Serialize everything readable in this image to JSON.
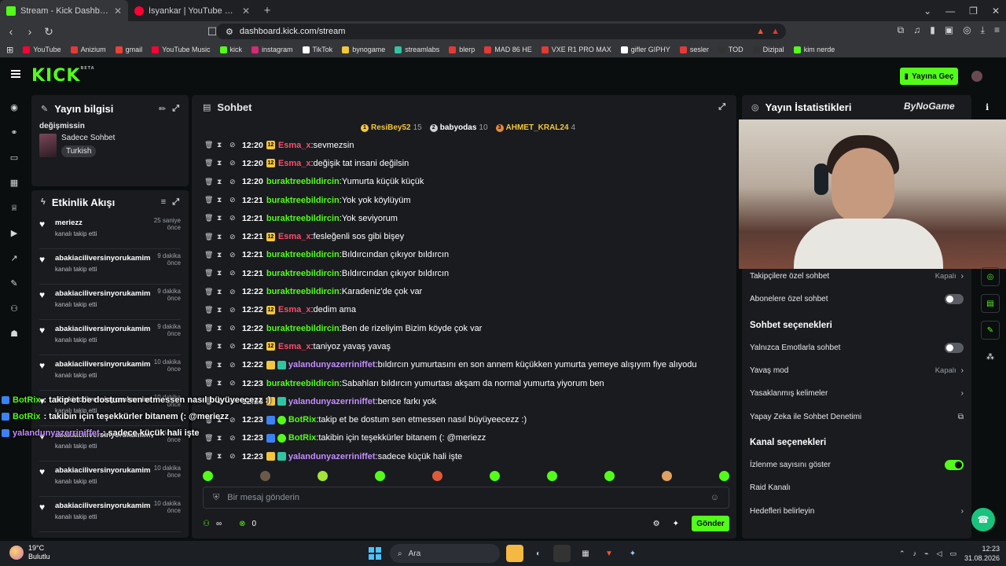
{
  "browser": {
    "tabs": [
      {
        "title": "Stream - Kick Dashboard",
        "color": "#53fc18",
        "active": true
      },
      {
        "title": "İsyankar | YouTube Music",
        "color": "#ff0033",
        "active": false
      }
    ],
    "url": "dashboard.kick.com/stream",
    "bookmarks": [
      {
        "label": "YouTube",
        "color": "#ff0033"
      },
      {
        "label": "Anizium",
        "color": "#e53935"
      },
      {
        "label": "gmail",
        "color": "#ea4335"
      },
      {
        "label": "YouTube Music",
        "color": "#ff0033"
      },
      {
        "label": "kick",
        "color": "#53fc18"
      },
      {
        "label": "instagram",
        "color": "#d62976"
      },
      {
        "label": "TikTok",
        "color": "#ffffff"
      },
      {
        "label": "bynogame",
        "color": "#f4c63b"
      },
      {
        "label": "streamlabs",
        "color": "#31c3a2"
      },
      {
        "label": "blerp",
        "color": "#e53935"
      },
      {
        "label": "MAD 86 HE",
        "color": "#e53935"
      },
      {
        "label": "VXE R1 PRO MAX",
        "color": "#e53935"
      },
      {
        "label": "gifler GIPHY",
        "color": "#ffffff"
      },
      {
        "label": "sesler",
        "color": "#e53935"
      },
      {
        "label": "TOD",
        "color": "#333333"
      },
      {
        "label": "Dizipal",
        "color": "#333333"
      },
      {
        "label": "kim nerde",
        "color": "#53fc18"
      }
    ]
  },
  "header": {
    "logo": "KICK",
    "logo_beta": "BETA",
    "go_live": "Yayına Geç"
  },
  "stream_info": {
    "heading": "Yayın bilgisi",
    "title": "değişmissin",
    "category": "Sadece Sohbet",
    "tag": "Turkish"
  },
  "activity": {
    "heading": "Etkinlik Akışı",
    "items": [
      {
        "user": "meriezz",
        "action": "kanalı takip etti",
        "time": "25 saniye önce"
      },
      {
        "user": "abakiaciliversinyorukamim",
        "action": "kanalı takip etti",
        "time": "9 dakika önce"
      },
      {
        "user": "abakiaciliversinyorukamim",
        "action": "kanalı takip etti",
        "time": "9 dakika önce"
      },
      {
        "user": "abakiaciliversinyorukamim",
        "action": "kanalı takip etti",
        "time": "9 dakika önce"
      },
      {
        "user": "abakiaciliversinyorukamim",
        "action": "kanalı takip etti",
        "time": "10 dakika önce"
      },
      {
        "user": "abakiaciliversinyorukamim",
        "action": "kanalı takip etti",
        "time": "10 dakika önce"
      },
      {
        "user": "abakiaciliversinyorukamim",
        "action": "kanalı takip etti",
        "time": "10 dakika önce"
      },
      {
        "user": "abakiaciliversinyorukamim",
        "action": "kanalı takip etti",
        "time": "10 dakika önce"
      },
      {
        "user": "abakiaciliversinyorukamim",
        "action": "kanalı takip etti",
        "time": "10 dakika önce"
      }
    ]
  },
  "chat": {
    "heading": "Sohbet",
    "pinned": [
      {
        "name": "ResiBey52",
        "count": "15",
        "color": "#f4c63b"
      },
      {
        "name": "babyodas",
        "count": "10",
        "color": "#cfd2d6"
      },
      {
        "name": "AHMET_KRAL24",
        "count": "4",
        "color": "#e58a3c"
      }
    ],
    "messages": [
      {
        "time": "12:20",
        "user": "Esma_x",
        "color": "#ff4d6a",
        "badge": "12",
        "text": "sevmezsin"
      },
      {
        "time": "12:20",
        "user": "Esma_x",
        "color": "#ff4d6a",
        "badge": "12",
        "text": "değişik tat insani değilsin"
      },
      {
        "time": "12:20",
        "user": "buraktreebildircin",
        "color": "#53fc18",
        "badge": "",
        "text": "Yumurta küçük küçük"
      },
      {
        "time": "12:21",
        "user": "buraktreebildircin",
        "color": "#53fc18",
        "badge": "",
        "text": "Yok yok köylüyüm"
      },
      {
        "time": "12:21",
        "user": "buraktreebildircin",
        "color": "#53fc18",
        "badge": "",
        "text": "Yok seviyorum"
      },
      {
        "time": "12:21",
        "user": "Esma_x",
        "color": "#ff4d6a",
        "badge": "12",
        "text": "fesleğenli sos gibi bişey"
      },
      {
        "time": "12:21",
        "user": "buraktreebildircin",
        "color": "#53fc18",
        "badge": "",
        "text": "Bıldırcından çıkıyor bıldırcın"
      },
      {
        "time": "12:21",
        "user": "buraktreebildircin",
        "color": "#53fc18",
        "badge": "",
        "text": "Bıldırcından çıkıyor bıldırcın"
      },
      {
        "time": "12:22",
        "user": "buraktreebildircin",
        "color": "#53fc18",
        "badge": "",
        "text": "Karadeniz'de çok var"
      },
      {
        "time": "12:22",
        "user": "Esma_x",
        "color": "#ff4d6a",
        "badge": "12",
        "text": "dedim ama"
      },
      {
        "time": "12:22",
        "user": "buraktreebildircin",
        "color": "#53fc18",
        "badge": "",
        "text": "Ben de rizeliyim Bizim köyde çok var"
      },
      {
        "time": "12:22",
        "user": "Esma_x",
        "color": "#ff4d6a",
        "badge": "12",
        "text": "taniyoz yavaş yavaş"
      },
      {
        "time": "12:22",
        "user": "yalandunyazerriniffet",
        "color": "#c48cff",
        "badge": "crown",
        "text": "bıldırcın yumurtasını en son annem küçükken yumurta yemeye alışıyım fiye alıyodu"
      },
      {
        "time": "12:23",
        "user": "buraktreebildircin",
        "color": "#53fc18",
        "badge": "",
        "text": "Sabahları bıldırcın yumurtası akşam da normal yumurta yiyorum ben"
      },
      {
        "time": "12:23",
        "user": "yalandunyazerriniffet",
        "color": "#c48cff",
        "badge": "crown",
        "text": "bence farkı yok"
      },
      {
        "time": "12:23",
        "user": "BotRix",
        "color": "#53fc18",
        "badge": "bot",
        "text": "takip et be dostum sen etmessen nasıl büyüyeecezz :)"
      },
      {
        "time": "12:23",
        "user": "BotRix",
        "color": "#53fc18",
        "badge": "bot",
        "text": "takibin için teşekkürler bitanem (: @meriezz"
      },
      {
        "time": "12:23",
        "user": "yalandunyazerriniffet",
        "color": "#c48cff",
        "badge": "crown",
        "text": "sadece küçük hali işte"
      }
    ],
    "input_placeholder": "Bir mesaj gönderin",
    "infinity_label": "∞",
    "points": "0",
    "send": "Gönder"
  },
  "overlay": [
    {
      "user": "BotRix",
      "text": ": takip et be dostum sen etmessen nasıl büyüyeecezz :)"
    },
    {
      "user": "BotRix",
      "text": ": takibin için teşekkürler bitanem (: @meriezz"
    },
    {
      "user": "yalandunyazerriniffet",
      "text": ": sadece küçük hali işte"
    }
  ],
  "stats": {
    "heading": "Yayın İstatistikleri",
    "overlay_logo": "ByNoGame",
    "rows": [
      {
        "label": "Takipçilere özel sohbet",
        "value": "Kapalı",
        "kind": "chevron"
      },
      {
        "label": "Abonelere özel sohbet",
        "value": "",
        "kind": "toggle-off"
      },
      {
        "label": "Sohbet seçenekleri",
        "value": "",
        "kind": "section"
      },
      {
        "label": "Yalnızca Emotlarla sohbet",
        "value": "",
        "kind": "toggle-off"
      },
      {
        "label": "Yavaş mod",
        "value": "Kapalı",
        "kind": "chevron"
      },
      {
        "label": "Yasaklanmış kelimeler",
        "value": "",
        "kind": "chevron"
      },
      {
        "label": "Yapay Zeka ile Sohbet Denetimi",
        "value": "",
        "kind": "external"
      },
      {
        "label": "Kanal seçenekleri",
        "value": "",
        "kind": "section"
      },
      {
        "label": "İzlenme sayısını göster",
        "value": "",
        "kind": "toggle-on"
      },
      {
        "label": "Raid Kanalı",
        "value": "",
        "kind": "none"
      },
      {
        "label": "Hedefleri belirleyin",
        "value": "",
        "kind": "chevron"
      }
    ]
  },
  "taskbar": {
    "temp": "19°C",
    "weather": "Bulutlu",
    "search": "Ara",
    "time": "12:23",
    "date": "31.08.2026"
  }
}
